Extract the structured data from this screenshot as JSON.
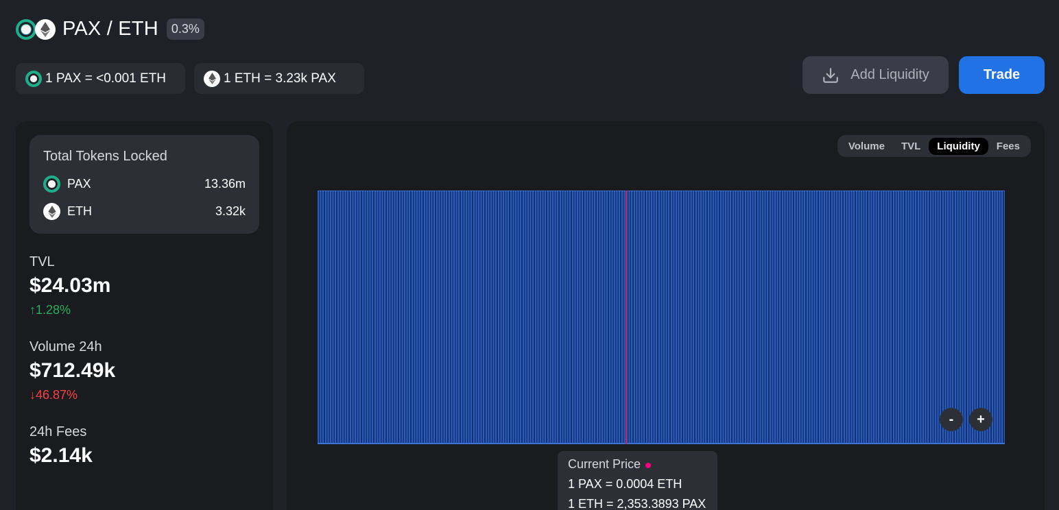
{
  "pair": {
    "title": "PAX / ETH",
    "fee_tier": "0.3%"
  },
  "rates": {
    "pax_to_eth": "1 PAX = <0.001 ETH",
    "eth_to_pax": "1 ETH = 3.23k PAX"
  },
  "actions": {
    "add_liquidity": "Add Liquidity",
    "trade": "Trade"
  },
  "tokens_locked": {
    "title": "Total Tokens Locked",
    "rows": [
      {
        "symbol": "PAX",
        "amount": "13.36m",
        "icon": "pax-icon"
      },
      {
        "symbol": "ETH",
        "amount": "3.32k",
        "icon": "eth-icon"
      }
    ]
  },
  "stats": {
    "tvl": {
      "label": "TVL",
      "value": "$24.03m",
      "change": "1.28%",
      "direction": "up"
    },
    "volume": {
      "label": "Volume 24h",
      "value": "$712.49k",
      "change": "46.87%",
      "direction": "down"
    },
    "fees": {
      "label": "24h Fees",
      "value": "$2.14k"
    }
  },
  "chart": {
    "tabs": [
      "Volume",
      "TVL",
      "Liquidity",
      "Fees"
    ],
    "active_tab": "Liquidity",
    "zoom_out": "-",
    "zoom_in": "+",
    "tooltip": {
      "title": "Current Price",
      "line1": "1 PAX = 0.0004 ETH",
      "line2": "1 ETH = 2,353.3893 PAX"
    }
  },
  "colors": {
    "accent": "#2172e5",
    "up": "#27ae60",
    "down": "#fd4040",
    "current_price": "#ff007a",
    "liquidity_bar": "#2a5cc0"
  }
}
